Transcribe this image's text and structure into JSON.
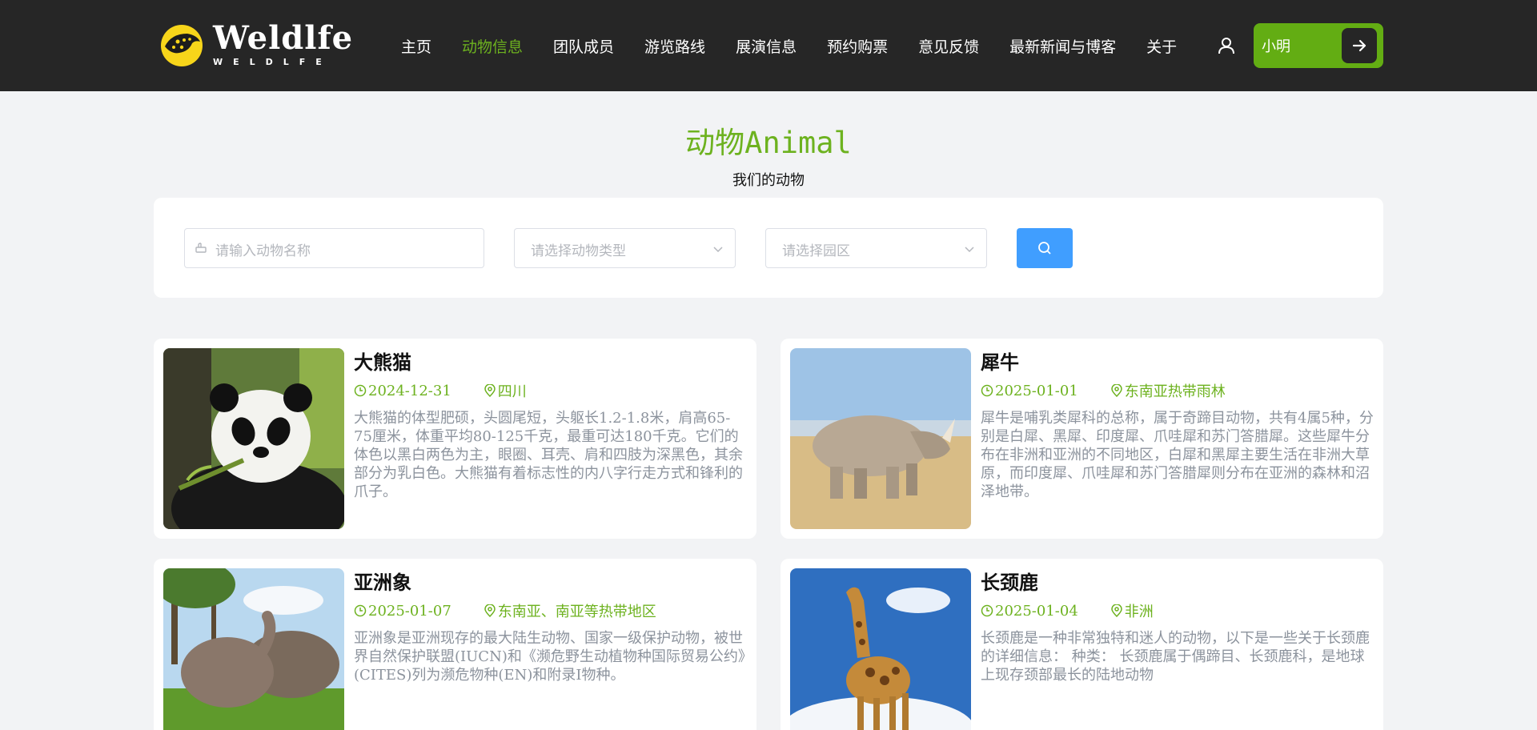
{
  "brand": {
    "name": "Weldlfe",
    "sub": "WELDLFE"
  },
  "nav": {
    "items": [
      {
        "label": "主页",
        "active": false
      },
      {
        "label": "动物信息",
        "active": true
      },
      {
        "label": "团队成员",
        "active": false
      },
      {
        "label": "游览路线",
        "active": false
      },
      {
        "label": "展演信息",
        "active": false
      },
      {
        "label": "预约购票",
        "active": false
      },
      {
        "label": "意见反馈",
        "active": false
      },
      {
        "label": "最新新闻与博客",
        "active": false
      },
      {
        "label": "关于",
        "active": false
      }
    ],
    "user_name": "小明"
  },
  "page": {
    "title": "动物Animal",
    "subtitle": "我们的动物"
  },
  "search": {
    "name_placeholder": "请输入动物名称",
    "type_placeholder": "请选择动物类型",
    "park_placeholder": "请选择园区"
  },
  "animals": [
    {
      "name": "大熊猫",
      "date": "2024-12-31",
      "location": "四川",
      "desc": "大熊猫的体型肥硕，头圆尾短，头躯长1.2-1.8米，肩高65-75厘米，体重平均80-125千克，最重可达180千克。它们的体色以黑白两色为主，眼圈、耳壳、肩和四肢为深黑色，其余部分为乳白色。大熊猫有着标志性的内八字行走方式和锋利的爪子。"
    },
    {
      "name": "犀牛",
      "date": "2025-01-01",
      "location": "东南亚热带雨林",
      "desc": "犀牛是哺乳类犀科的总称，属于奇蹄目动物，共有4属5种，分别是白犀、黑犀、印度犀、爪哇犀和苏门答腊犀。这些犀牛分布在非洲和亚洲的不同地区，白犀和黑犀主要生活在非洲大草原，而印度犀、爪哇犀和苏门答腊犀则分布在亚洲的森林和沼泽地带。"
    },
    {
      "name": "亚洲象",
      "date": "2025-01-07",
      "location": "东南亚、南亚等热带地区",
      "desc": "亚洲象是亚洲现存的最大陆生动物、国家一级保护动物，被世界自然保护联盟(IUCN)和《濒危野生动植物种国际贸易公约》(CITES)列为濒危物种(EN)和附录Ⅰ物种。"
    },
    {
      "name": "长颈鹿",
      "date": "2025-01-04",
      "location": "非洲",
      "desc": "长颈鹿是一种非常独特和迷人的动物，以下是一些关于长颈鹿的详细信息： 种类： 长颈鹿属于偶蹄目、长颈鹿科，是地球上现存颈部最长的陆地动物"
    }
  ],
  "colors": {
    "accent": "#6db21f",
    "header": "#262626",
    "search_button": "#409eff"
  }
}
